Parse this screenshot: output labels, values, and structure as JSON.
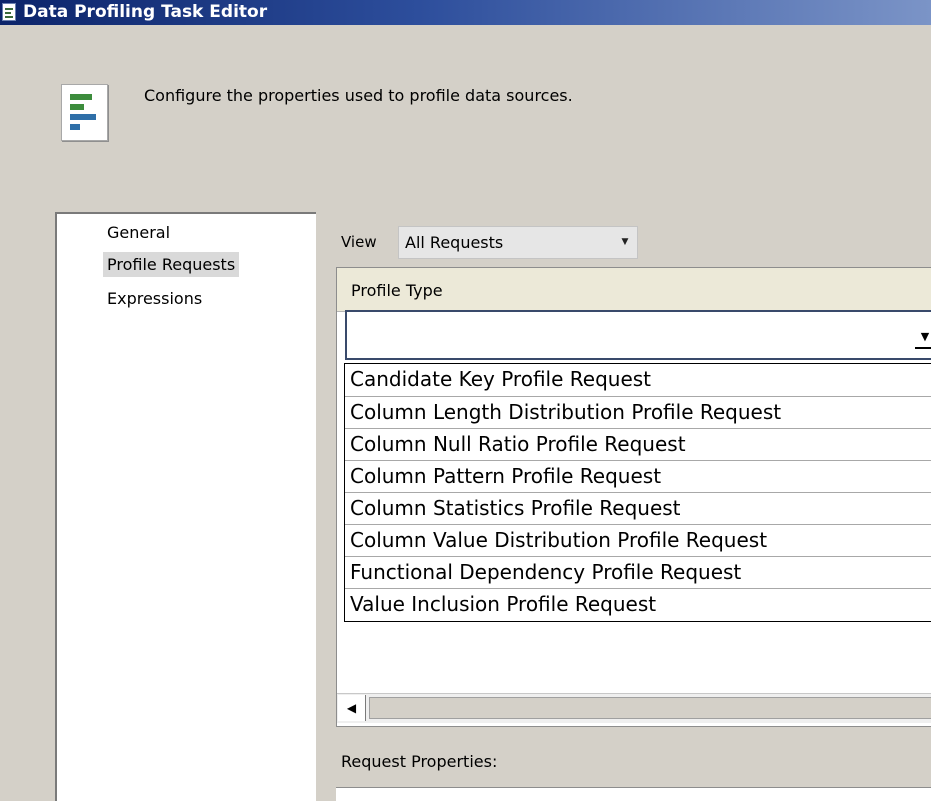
{
  "window": {
    "title": "Data Profiling Task Editor",
    "description": "Configure the properties used to profile data sources."
  },
  "nav": {
    "items": [
      {
        "label": "General",
        "selected": false
      },
      {
        "label": "Profile Requests",
        "selected": true
      },
      {
        "label": "Expressions",
        "selected": false
      }
    ]
  },
  "view": {
    "label": "View",
    "selected": "All Requests"
  },
  "grid": {
    "column_header": "Profile Type",
    "combo_value": ""
  },
  "profile_types": [
    "Candidate Key Profile Request",
    "Column Length Distribution Profile Request",
    "Column Null Ratio Profile Request",
    "Column Pattern Profile Request",
    "Column Statistics Profile Request",
    "Column Value Distribution Profile Request",
    "Functional Dependency Profile Request",
    "Value Inclusion Profile Request"
  ],
  "request_properties": {
    "label": "Request Properties:"
  },
  "icons": {
    "title": "document-icon",
    "header": "data-profile-icon",
    "dropdown": "chevron-down-icon",
    "scroll_left": "arrow-left-icon"
  },
  "colors": {
    "titlebar_start": "#0c246a",
    "titlebar_end": "#7b94c7",
    "dialog_background": "#d4d0c8",
    "selected_nav": "#d9d9d9"
  }
}
